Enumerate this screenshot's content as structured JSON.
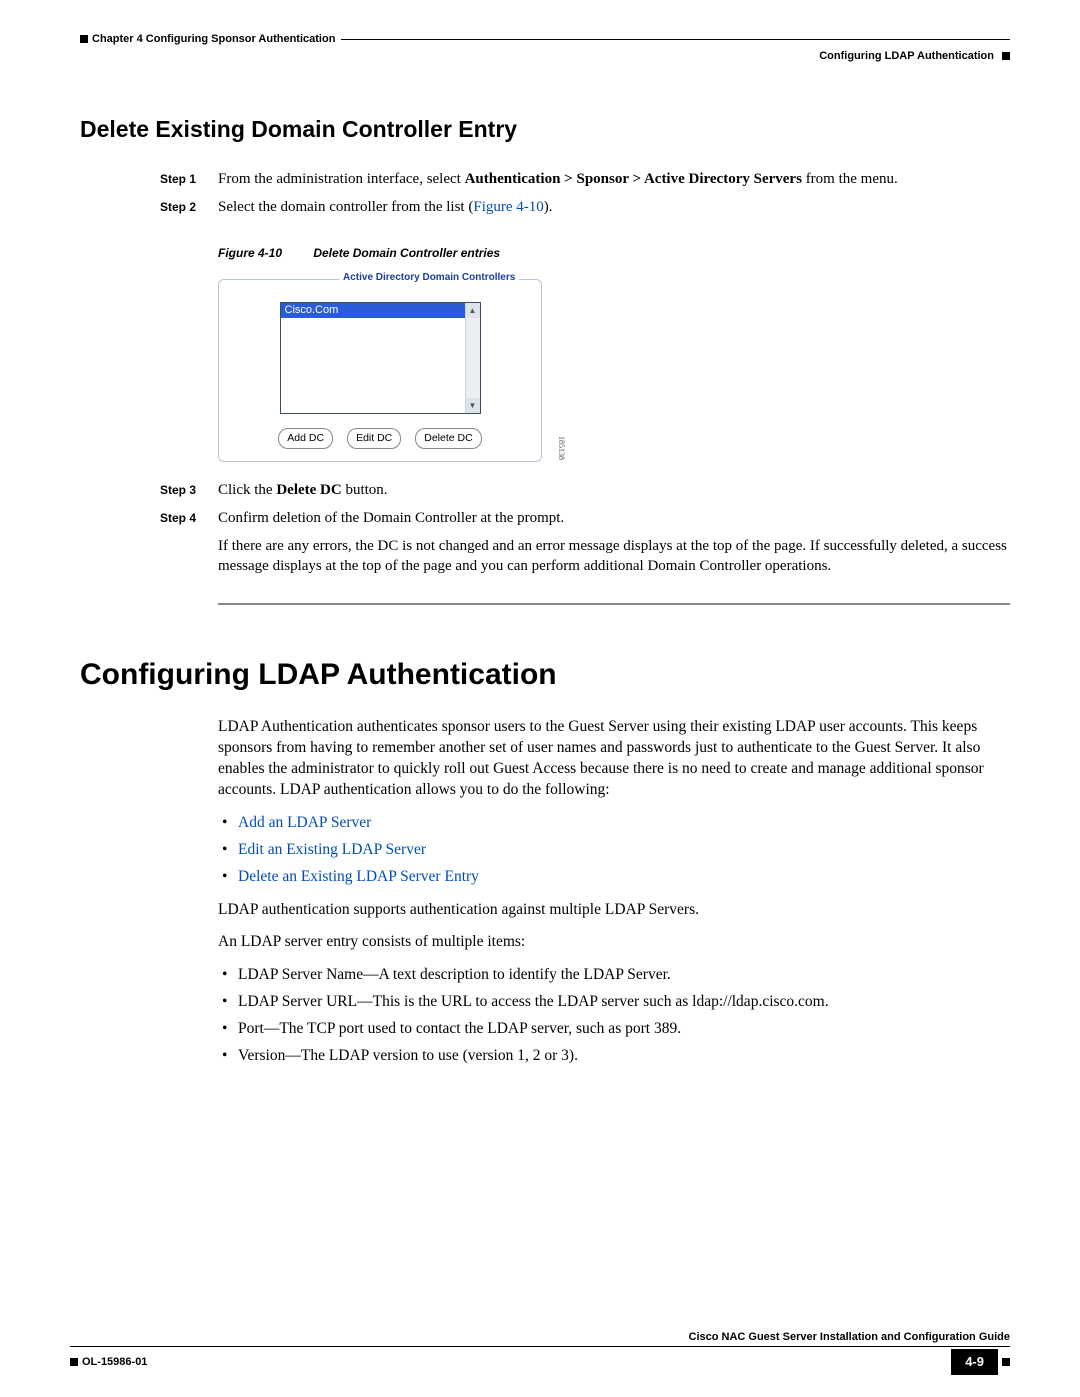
{
  "header": {
    "chapter_line": "Chapter 4    Configuring Sponsor Authentication",
    "section_line": "Configuring LDAP Authentication"
  },
  "section1": {
    "heading": "Delete Existing Domain Controller Entry",
    "steps": {
      "s1_label": "Step 1",
      "s1_prefix": "From the administration interface, select ",
      "s1_bold": "Authentication > Sponsor > Active Directory Servers",
      "s1_suffix": " from the menu.",
      "s2_label": "Step 2",
      "s2_prefix": "Select the domain controller from the list (",
      "s2_link": "Figure 4-10",
      "s2_suffix": ").",
      "s3_label": "Step 3",
      "s3_prefix": "Click the ",
      "s3_bold": "Delete DC",
      "s3_suffix": " button.",
      "s4_label": "Step 4",
      "s4_text": "Confirm deletion of the Domain Controller at the prompt.",
      "s4_para": "If there are any errors, the DC is not changed and an error message displays at the top of the page. If successfully deleted, a success message displays at the top of the page and you can perform additional Domain Controller operations."
    },
    "figure": {
      "label": "Figure 4-10",
      "title": "Delete Domain Controller entries",
      "legend": "Active Directory Domain Controllers",
      "selected_item": "Cisco.Com",
      "btn_add": "Add DC",
      "btn_edit": "Edit DC",
      "btn_delete": "Delete DC",
      "imgid": "185138"
    }
  },
  "section2": {
    "heading": "Configuring LDAP Authentication",
    "intro": "LDAP Authentication authenticates sponsor users to the Guest Server using their existing LDAP user accounts. This keeps sponsors from having to remember another set of user names and passwords just to authenticate to the Guest Server. It also enables the administrator to quickly roll out Guest Access because there is no need to create and manage additional sponsor accounts. LDAP authentication allows you to do the following:",
    "links": {
      "l1": "Add an LDAP Server",
      "l2": "Edit an Existing LDAP Server",
      "l3": "Delete an Existing LDAP Server Entry"
    },
    "p2": "LDAP authentication supports authentication against multiple LDAP Servers.",
    "p3": "An LDAP server entry consists of multiple items:",
    "items": {
      "i1": "LDAP Server Name—A text description to identify the LDAP Server.",
      "i2": "LDAP Server URL—This is the URL to access the LDAP server such as ldap://ldap.cisco.com.",
      "i3": "Port—The TCP port used to contact the LDAP server, such as port 389.",
      "i4": "Version—The LDAP version to use (version 1, 2 or 3)."
    }
  },
  "footer": {
    "guide": "Cisco NAC Guest Server Installation and Configuration Guide",
    "ol": "OL-15986-01",
    "pageno": "4-9"
  }
}
